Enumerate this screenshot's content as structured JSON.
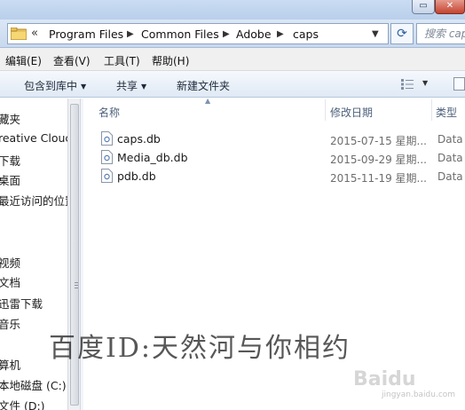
{
  "address": {
    "crumbs": [
      "Program Files",
      "Common Files",
      "Adobe",
      "caps"
    ],
    "search_placeholder": "搜索 caps"
  },
  "menu": [
    "编辑(E)",
    "查看(V)",
    "工具(T)",
    "帮助(H)"
  ],
  "commands": {
    "include_library": "包含到库中",
    "share": "共享",
    "new_folder": "新建文件夹"
  },
  "nav": {
    "items": [
      "藏夹",
      "reative Clouc",
      "下载",
      "桌面",
      "最近访问的位置",
      "视频",
      "文档",
      "迅雷下载",
      "音乐",
      "算机",
      "本地磁盘 (C:)",
      "文件 (D:)"
    ]
  },
  "columns": {
    "name": "名称",
    "date": "修改日期",
    "type": "类型"
  },
  "files": [
    {
      "name": "caps.db",
      "date": "2015-07-15 星期...",
      "type": "Data"
    },
    {
      "name": "Media_db.db",
      "date": "2015-09-29 星期...",
      "type": "Data"
    },
    {
      "name": "pdb.db",
      "date": "2015-11-19 星期...",
      "type": "Data"
    }
  ],
  "watermark": "百度ID:天然河与你相约",
  "baidu_logo": "Baidu",
  "baidu_sub": "jingyan.baidu.com"
}
